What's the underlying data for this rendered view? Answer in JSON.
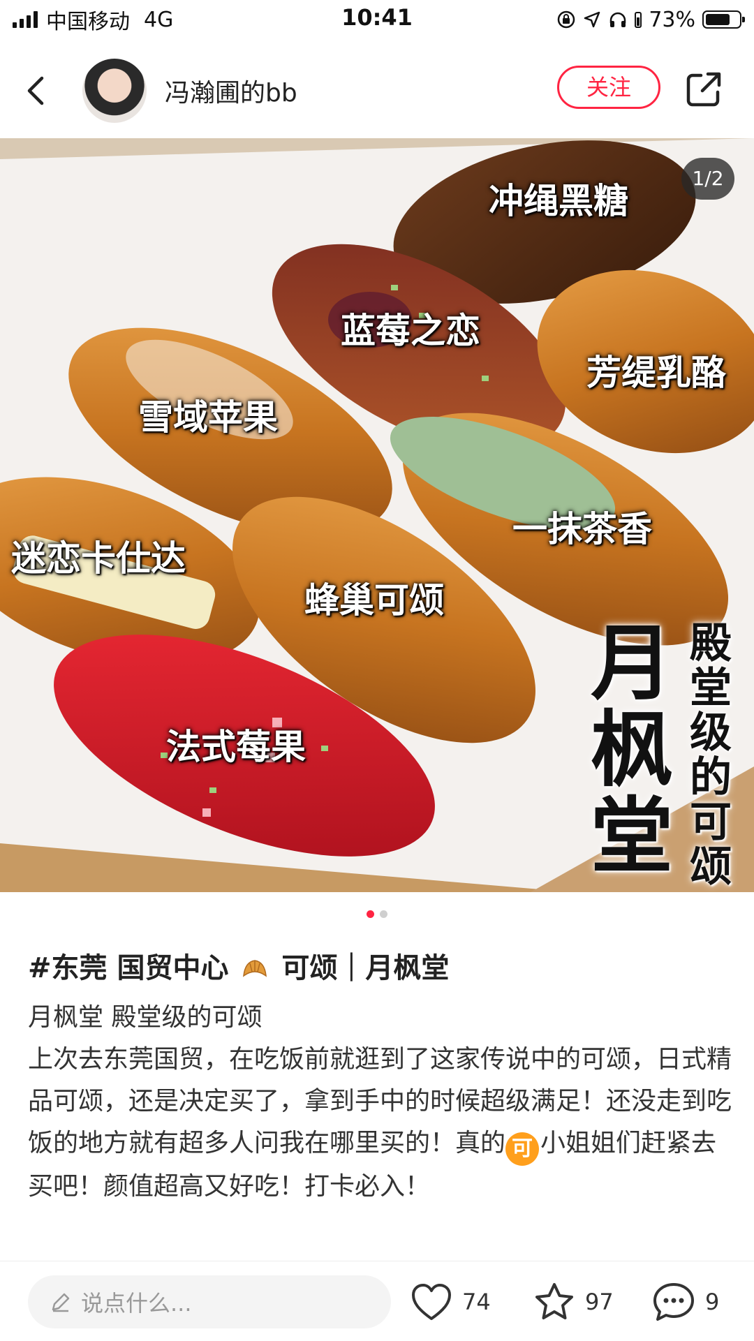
{
  "status_bar": {
    "carrier": "中国移动",
    "network": "4G",
    "time": "10:41",
    "battery": "73%",
    "battery_level": 0.73
  },
  "header": {
    "username": "冯瀚圃的bb",
    "follow_label": "关注"
  },
  "image": {
    "page_counter": "1/2",
    "labels": [
      "冲绳黑糖",
      "蓝莓之恋",
      "芳缇乳酪",
      "雪域苹果",
      "一抹茶香",
      "迷恋卡仕达",
      "蜂巢可颂",
      "法式莓果"
    ],
    "big_title": "月枫堂",
    "side_title": "殿堂级的可颂"
  },
  "post": {
    "title_before": "#东莞 国贸中心",
    "title_after": "可颂｜月枫堂",
    "line1": "月枫堂 殿堂级的可颂",
    "para_start": "上次去东莞国贸，在吃饭前就逛到了这家传说中的可颂，日式精品可颂，还是决定买了，拿到手中的时候超级满足！还没走到吃饭的地方就有超多人问我在哪里买的！真的",
    "badge": "可",
    "para_end": "小姐姐们赶紧去买吧！颜值超高又好吃！打卡必入！"
  },
  "bottom_bar": {
    "comment_placeholder": "说点什么...",
    "likes": "74",
    "favorites": "97",
    "comments": "9"
  },
  "colors": {
    "accent": "#ff2442",
    "badge_orange": "#ff9f1c"
  }
}
